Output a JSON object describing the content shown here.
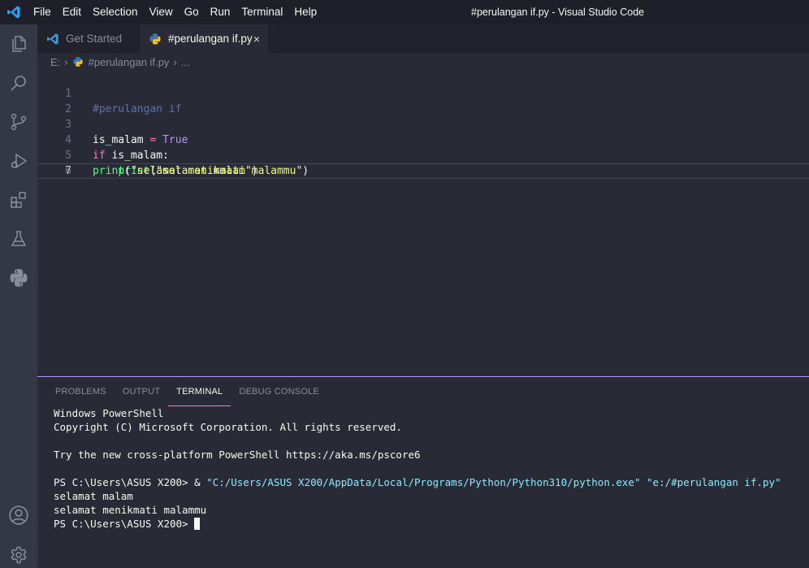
{
  "window": {
    "title": "#perulangan if.py - Visual Studio Code"
  },
  "menu": [
    "File",
    "Edit",
    "Selection",
    "View",
    "Go",
    "Run",
    "Terminal",
    "Help"
  ],
  "activity_bar": {
    "top": [
      "files-icon",
      "search-icon",
      "source-control-icon",
      "run-debug-icon",
      "extensions-icon",
      "testing-icon",
      "python-icon"
    ],
    "bottom": [
      "accounts-icon",
      "settings-gear-icon"
    ]
  },
  "tabs": [
    {
      "label": "Get Started",
      "icon": "vscode-icon",
      "active": false
    },
    {
      "label": "#perulangan if.py",
      "icon": "python-file-icon",
      "active": true,
      "close": "×"
    }
  ],
  "breadcrumb": {
    "drive": "E:",
    "file": "#perulangan if.py",
    "more": "..."
  },
  "editor": {
    "current_line": 7,
    "lines": [
      {
        "n": "1",
        "tokens": [
          {
            "t": "#perulangan if",
            "c": "comment"
          }
        ]
      },
      {
        "n": "2",
        "tokens": []
      },
      {
        "n": "3",
        "tokens": [
          {
            "t": "is_malam ",
            "c": "plain"
          },
          {
            "t": "=",
            "c": "op"
          },
          {
            "t": " ",
            "c": "plain"
          },
          {
            "t": "True",
            "c": "const"
          }
        ]
      },
      {
        "n": "4",
        "tokens": [
          {
            "t": "if",
            "c": "kw"
          },
          {
            "t": " is_malam:",
            "c": "plain"
          }
        ]
      },
      {
        "n": "5",
        "tokens": [
          {
            "t": "    ",
            "c": "plain"
          },
          {
            "t": "print",
            "c": "fn"
          },
          {
            "t": "(",
            "c": "plain"
          },
          {
            "t": "\"selamat malam\"",
            "c": "str"
          },
          {
            "t": ")",
            "c": "plain"
          }
        ]
      },
      {
        "n": "6",
        "tokens": []
      },
      {
        "n": "7",
        "tokens": [
          {
            "t": "print",
            "c": "fn"
          },
          {
            "t": "(",
            "c": "plain"
          },
          {
            "t": "\"selamat menikmati malammu\"",
            "c": "str"
          },
          {
            "t": ")",
            "c": "plain"
          }
        ]
      }
    ]
  },
  "panel": {
    "tabs": [
      "PROBLEMS",
      "OUTPUT",
      "TERMINAL",
      "DEBUG CONSOLE"
    ],
    "active_tab": "TERMINAL",
    "terminal": {
      "line1": "Windows PowerShell",
      "line2": "Copyright (C) Microsoft Corporation. All rights reserved.",
      "line3": "Try the new cross-platform PowerShell https://aka.ms/pscore6",
      "prompt": "PS C:\\Users\\ASUS X200> ",
      "cmd_amp": "& ",
      "cmd_exe": "\"C:/Users/ASUS X200/AppData/Local/Programs/Python/Python310/python.exe\"",
      "cmd_space": " ",
      "cmd_file": "\"e:/#perulangan if.py\"",
      "out1": "selamat malam",
      "out2": "selamat menikmati malammu",
      "prompt2": "PS C:\\Users\\ASUS X200> "
    }
  },
  "colors": {
    "accent": "#bd93f9",
    "terminal_highlight": "#8be9fd",
    "tab_underline": "#ff79c6"
  }
}
